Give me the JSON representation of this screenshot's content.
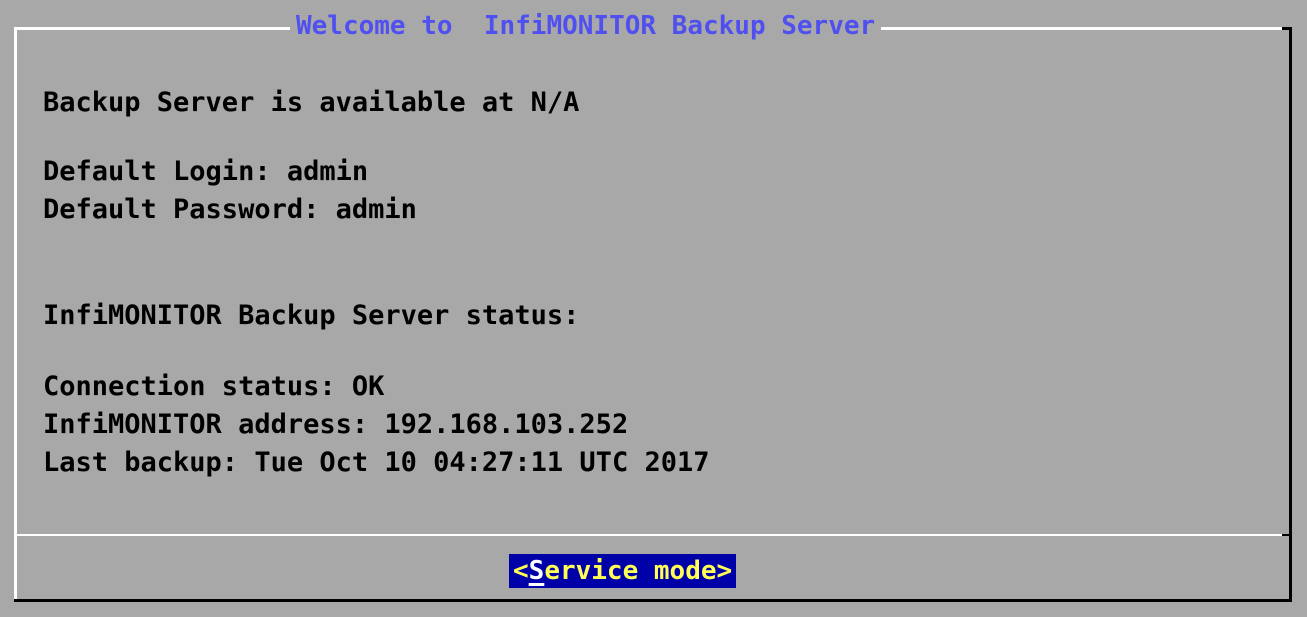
{
  "dialog": {
    "title": "Welcome to  InfiMONITOR Backup Server",
    "lines": {
      "availability": "Backup Server is available at N/A",
      "default_login": "Default Login: admin",
      "default_password": "Default Password: admin",
      "status_heading": "InfiMONITOR Backup Server status:",
      "connection_status": "Connection status: OK",
      "monitor_address": "InfiMONITOR address: 192.168.103.252",
      "last_backup": "Last backup: Tue Oct 10 04:27:11 UTC 2017"
    },
    "button": {
      "open": "<",
      "hotkey": "S",
      "rest": "ervice mode",
      "close": ">"
    },
    "colors": {
      "background": "#a8a8a8",
      "title": "#5050f0",
      "button_bg": "#0000a8",
      "button_text": "#ffff55"
    }
  }
}
